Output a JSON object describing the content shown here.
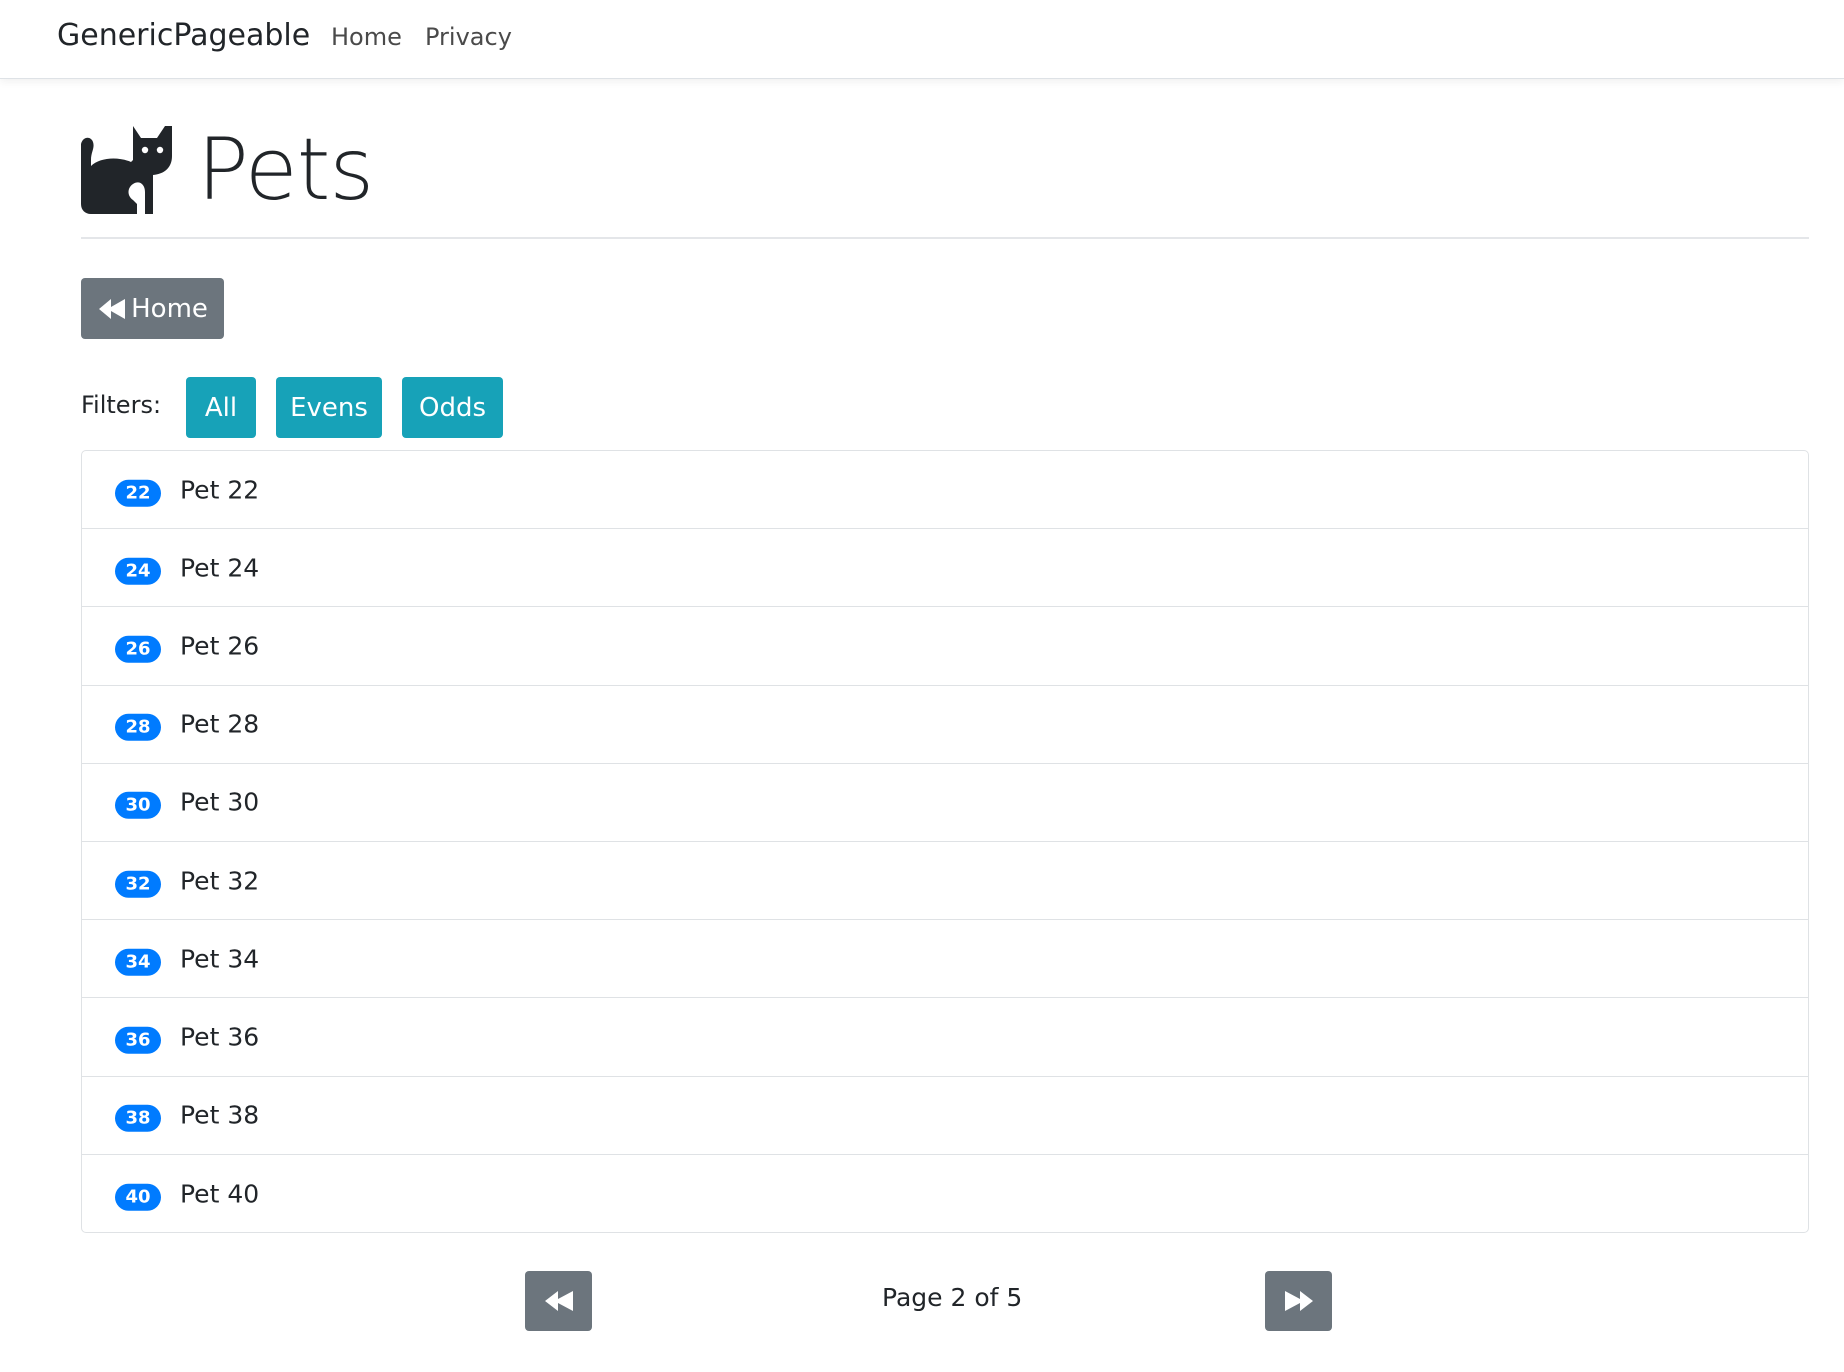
{
  "navbar": {
    "brand": "GenericPageable",
    "links": [
      "Home",
      "Privacy"
    ]
  },
  "header": {
    "icon": "cat-icon",
    "title": "Pets"
  },
  "home_button": {
    "icon": "backward-icon",
    "label": "Home"
  },
  "filters": {
    "label": "Filters:",
    "options": [
      "All",
      "Evens",
      "Odds"
    ]
  },
  "pets": [
    {
      "id": "22",
      "name": "Pet 22"
    },
    {
      "id": "24",
      "name": "Pet 24"
    },
    {
      "id": "26",
      "name": "Pet 26"
    },
    {
      "id": "28",
      "name": "Pet 28"
    },
    {
      "id": "30",
      "name": "Pet 30"
    },
    {
      "id": "32",
      "name": "Pet 32"
    },
    {
      "id": "34",
      "name": "Pet 34"
    },
    {
      "id": "36",
      "name": "Pet 36"
    },
    {
      "id": "38",
      "name": "Pet 38"
    },
    {
      "id": "40",
      "name": "Pet 40"
    }
  ],
  "pager": {
    "prev_icon": "backward-icon",
    "next_icon": "forward-icon",
    "indicator": "Page 2 of 5"
  },
  "colors": {
    "secondary": "#6c757d",
    "info": "#17a2b8",
    "badge": "#007bff",
    "text": "#212529",
    "border": "#dfe2e5"
  }
}
